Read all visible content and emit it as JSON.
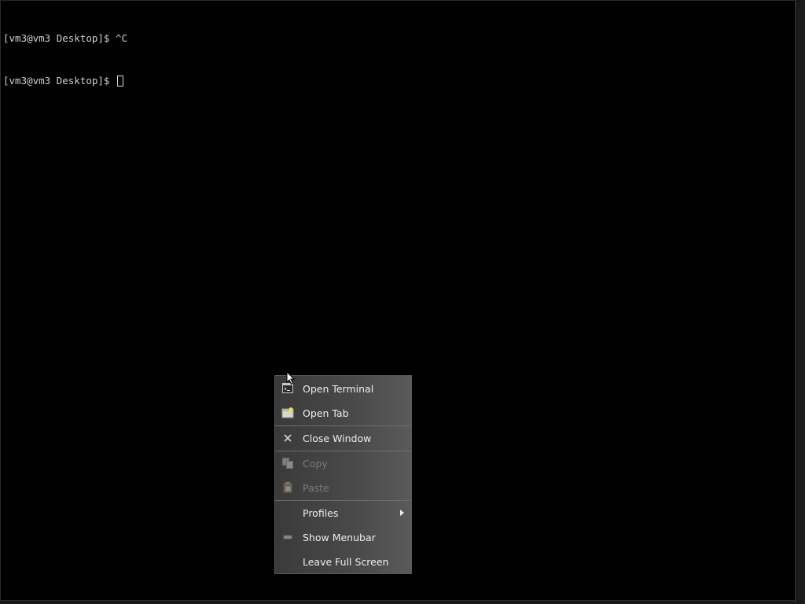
{
  "terminal": {
    "lines": [
      "[vm3@vm3 Desktop]$ ^C",
      "[vm3@vm3 Desktop]$ "
    ]
  },
  "context_menu": {
    "items": [
      {
        "label": "Open Terminal",
        "icon": "terminal-icon",
        "enabled": true
      },
      {
        "label": "Open Tab",
        "icon": "new-tab-icon",
        "enabled": true
      },
      {
        "label": "Close Window",
        "icon": "close-icon",
        "enabled": true
      },
      {
        "label": "Copy",
        "icon": "copy-icon",
        "enabled": false
      },
      {
        "label": "Paste",
        "icon": "paste-icon",
        "enabled": false
      },
      {
        "label": "Profiles",
        "icon": "",
        "enabled": true,
        "submenu": true
      },
      {
        "label": "Show Menubar",
        "icon": "menubar-icon",
        "enabled": true
      },
      {
        "label": "Leave Full Screen",
        "icon": "",
        "enabled": true
      }
    ]
  },
  "colors": {
    "terminal_background": "#000000",
    "terminal_text": "#cfcfcf",
    "menu_background": "#454545",
    "menu_text": "#eeeeee",
    "menu_text_disabled": "#7a7a7a"
  }
}
